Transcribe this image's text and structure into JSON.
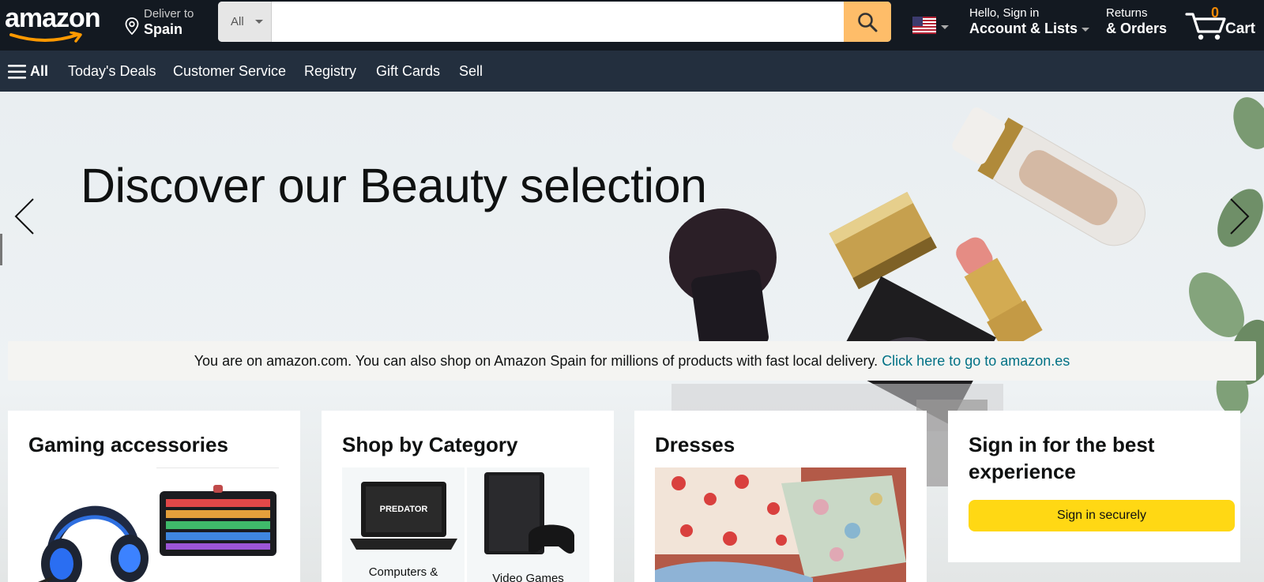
{
  "header": {
    "logo": "amazon",
    "deliver": {
      "line1": "Deliver to",
      "line2": "Spain",
      "icon": "location-pin-icon"
    },
    "search": {
      "category": "All",
      "placeholder": "",
      "button_icon": "search-icon"
    },
    "flag": "us-flag-icon",
    "account": {
      "line1": "Hello, Sign in",
      "line2": "Account & Lists"
    },
    "returns": {
      "line1": "Returns",
      "line2": "& Orders"
    },
    "cart": {
      "count": "0",
      "label": "Cart",
      "icon": "cart-icon"
    }
  },
  "subnav": {
    "all_label": "All",
    "links": [
      "Today's Deals",
      "Customer Service",
      "Registry",
      "Gift Cards",
      "Sell"
    ]
  },
  "hero": {
    "title": "Discover our Beauty selection"
  },
  "notice": {
    "text": "You are on amazon.com. You can also shop on Amazon Spain for millions of products with fast local delivery. ",
    "link": "Click here to go to amazon.es"
  },
  "cards": {
    "gaming": {
      "title": "Gaming accessories"
    },
    "category": {
      "title": "Shop by Category",
      "tiles": [
        "Computers &",
        "Video Games"
      ]
    },
    "dresses": {
      "title": "Dresses"
    },
    "signin": {
      "title": "Sign in for the best experience",
      "button": "Sign in securely"
    }
  },
  "colors": {
    "nav_dark": "#131921",
    "nav_sub": "#232f3e",
    "search_button": "#febd69",
    "cart_count": "#f08804",
    "link": "#007185",
    "signin_button": "#ffd814"
  }
}
